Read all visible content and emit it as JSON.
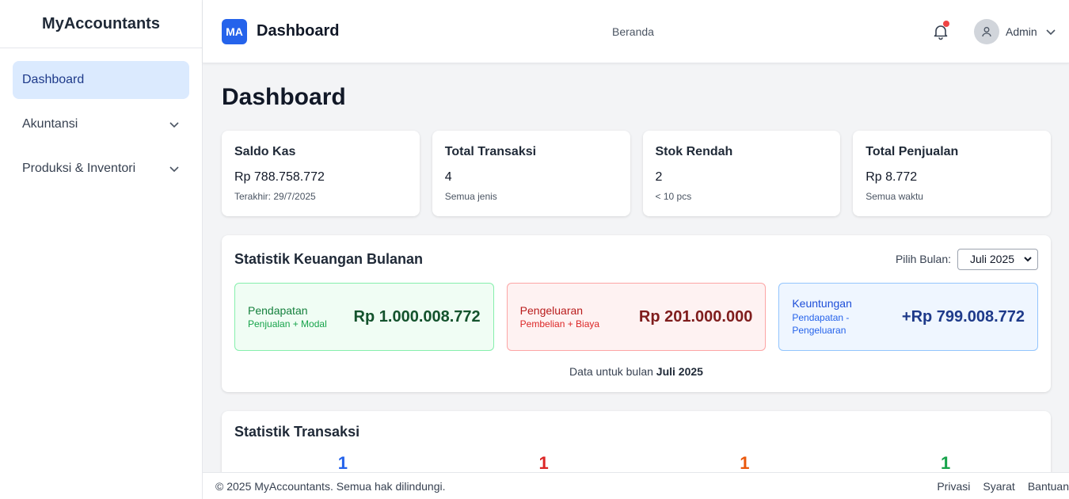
{
  "sidebar": {
    "brand": "MyAccountants",
    "items": [
      {
        "label": "Dashboard"
      },
      {
        "label": "Akuntansi"
      },
      {
        "label": "Produksi & Inventori"
      }
    ]
  },
  "header": {
    "logo": "MA",
    "title": "Dashboard",
    "breadcrumb": "Beranda",
    "notification_icon": "bell-icon",
    "user_name": "Admin"
  },
  "page": {
    "title": "Dashboard"
  },
  "cards": [
    {
      "title": "Saldo Kas",
      "value": "Rp 788.758.772",
      "sub": "Terakhir: 29/7/2025"
    },
    {
      "title": "Total Transaksi",
      "value": "4",
      "sub": "Semua jenis"
    },
    {
      "title": "Stok Rendah",
      "value": "2",
      "sub": "< 10 pcs"
    },
    {
      "title": "Total Penjualan",
      "value": "Rp 8.772",
      "sub": "Semua waktu"
    }
  ],
  "finance": {
    "title": "Statistik Keuangan Bulanan",
    "month_label": "Pilih Bulan:",
    "month_value": "Juli 2025",
    "income": {
      "label": "Pendapatan",
      "desc": "Penjualan + Modal",
      "amount": "Rp 1.000.008.772"
    },
    "expense": {
      "label": "Pengeluaran",
      "desc": "Pembelian + Biaya",
      "amount": "Rp 201.000.000"
    },
    "profit": {
      "label": "Keuntungan",
      "desc": "Pendapatan - Pengeluaran",
      "amount": "+Rp 799.008.772"
    },
    "note_prefix": "Data untuk bulan",
    "note_month": "Juli 2025"
  },
  "transactions": {
    "title": "Statistik Transaksi",
    "counts": [
      {
        "value": "1",
        "color": "#2563eb"
      },
      {
        "value": "1",
        "color": "#dc2626"
      },
      {
        "value": "1",
        "color": "#ea580c"
      },
      {
        "value": "1",
        "color": "#16a34a"
      }
    ]
  },
  "footer": {
    "copyright": "© 2025 MyAccountants. Semua hak dilindungi.",
    "links": [
      "Privasi",
      "Syarat",
      "Bantuan"
    ]
  },
  "colors": {
    "accent": "#2563eb",
    "active_nav_bg": "#dbeafe",
    "notification_dot": "#ef4444"
  }
}
